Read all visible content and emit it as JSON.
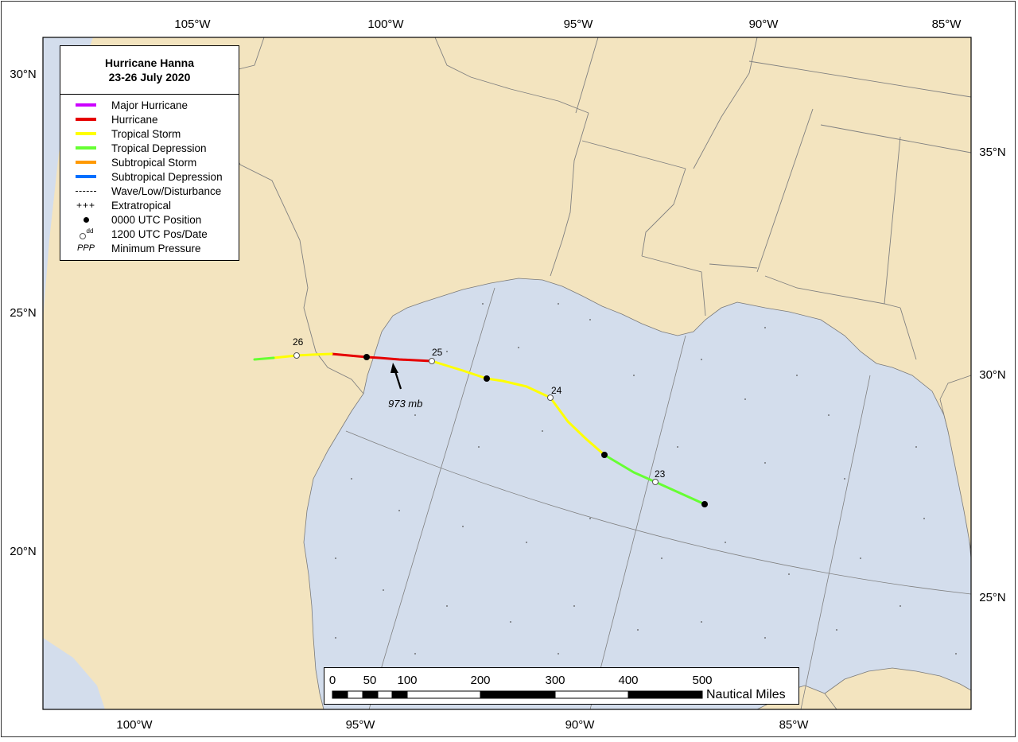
{
  "map": {
    "title_line1": "Hurricane Hanna",
    "title_line2": "23-26 July 2020",
    "top_lon_labels": [
      "105°W",
      "100°W",
      "95°W",
      "90°W",
      "85°W"
    ],
    "bottom_lon_labels": [
      "100°W",
      "95°W",
      "90°W",
      "85°W"
    ],
    "left_lat_labels": [
      "30°N",
      "25°N",
      "20°N"
    ],
    "right_lat_labels": [
      "35°N",
      "30°N",
      "25°N"
    ],
    "colors": {
      "land": "#f3e4bf",
      "water": "#d3ddec",
      "major_hurricane": "#cc00ff",
      "hurricane": "#e60000",
      "tropical_storm": "#ffff00",
      "tropical_depression": "#66ff33",
      "subtropical_storm": "#ff9900",
      "subtropical_depression": "#0070ff"
    }
  },
  "legend": {
    "items": [
      {
        "symbol": "bar",
        "color": "#cc00ff",
        "label": "Major Hurricane"
      },
      {
        "symbol": "bar",
        "color": "#e60000",
        "label": "Hurricane"
      },
      {
        "symbol": "bar",
        "color": "#ffff00",
        "label": "Tropical Storm"
      },
      {
        "symbol": "bar",
        "color": "#66ff33",
        "label": "Tropical Depression"
      },
      {
        "symbol": "bar",
        "color": "#ff9900",
        "label": "Subtropical Storm"
      },
      {
        "symbol": "bar",
        "color": "#0070ff",
        "label": "Subtropical Depression"
      },
      {
        "symbol": "dash",
        "label": "Wave/Low/Disturbance"
      },
      {
        "symbol": "plus",
        "text": "+++",
        "label": "Extratropical"
      },
      {
        "symbol": "dot",
        "label": "0000 UTC Position"
      },
      {
        "symbol": "odot",
        "text": "dd",
        "label": "1200 UTC Pos/Date"
      },
      {
        "symbol": "ppp",
        "text": "PPP",
        "label": "Minimum Pressure"
      }
    ]
  },
  "track": {
    "date_labels": [
      "26",
      "25",
      "24",
      "23"
    ],
    "min_pressure": "973 mb"
  },
  "scale": {
    "tick_labels": [
      "0",
      "50",
      "100",
      "200",
      "300",
      "400",
      "500"
    ],
    "unit": "Nautical Miles"
  }
}
